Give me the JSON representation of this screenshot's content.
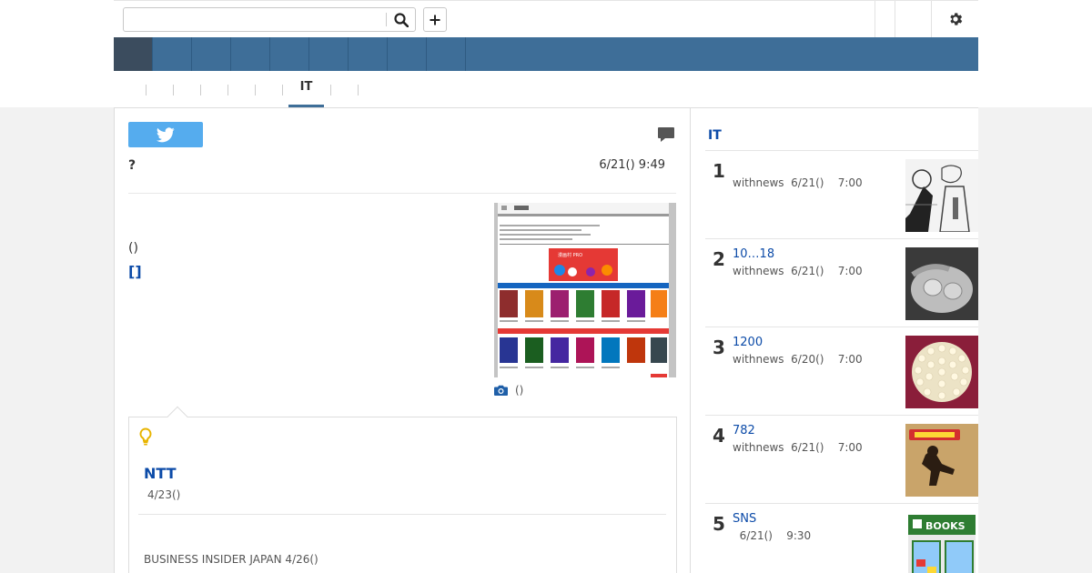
{
  "search": {
    "placeholder": "",
    "value": ""
  },
  "icons": {
    "search": "search-icon",
    "plus": "plus-icon",
    "gear": "gear-icon",
    "twitter": "twitter-icon",
    "comment": "comment-icon",
    "camera": "camera-icon",
    "bulb": "lightbulb-icon"
  },
  "colors": {
    "nav": "#3e6e98",
    "nav_active": "#3b4c5e",
    "link": "#0c4ba8",
    "twitter": "#55acee",
    "bulb": "#e8b400"
  },
  "category_tabs": {
    "active_label": "IT"
  },
  "article": {
    "headline": "?",
    "date": "6/21() 9:49",
    "body_text": "()",
    "body_link": "[]",
    "photo_caption": "()"
  },
  "related": {
    "title": "NTT",
    "date": "4/23()",
    "source": "BUSINESS INSIDER JAPAN 4/26()"
  },
  "ranking": {
    "title": "IT",
    "items": [
      {
        "rank": "1",
        "title": "",
        "source": "withnews",
        "date": "6/21()",
        "time": "7:00"
      },
      {
        "rank": "2",
        "title": "10…18",
        "source": "withnews",
        "date": "6/21()",
        "time": "7:00"
      },
      {
        "rank": "3",
        "title": "1200",
        "source": "withnews",
        "date": "6/20()",
        "time": "7:00"
      },
      {
        "rank": "4",
        "title": "782",
        "source": "withnews",
        "date": "6/21()",
        "time": "7:00"
      },
      {
        "rank": "5",
        "title": "SNS",
        "source": "",
        "date": "6/21()",
        "time": "9:30"
      }
    ]
  },
  "thumb_texts": {
    "books_sign": "BOOKS",
    "photo_banner": "漫画村 PRO"
  }
}
